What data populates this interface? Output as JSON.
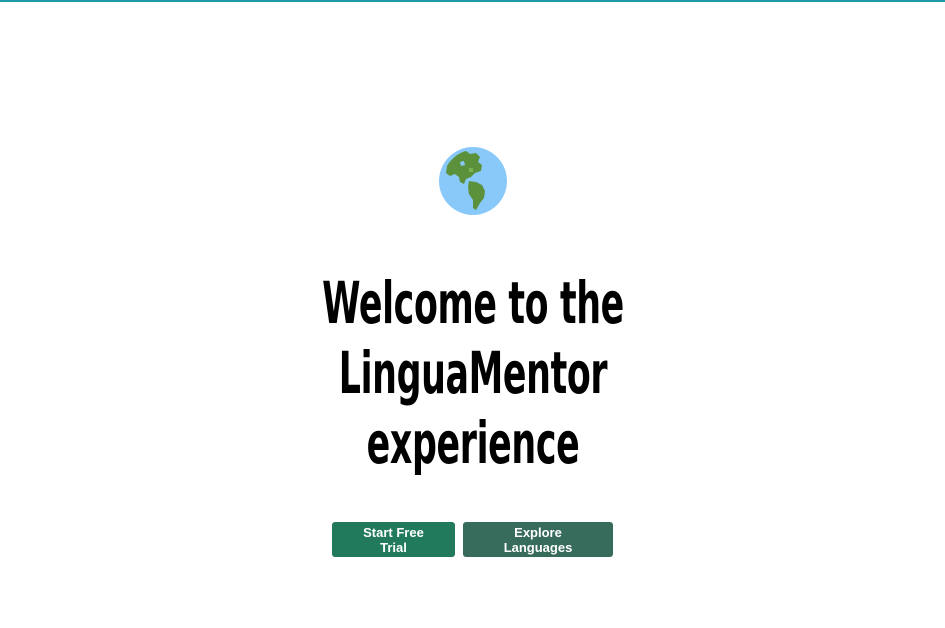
{
  "hero": {
    "icon": "globe-americas-icon",
    "headline": "Welcome to the LinguaMentor experience",
    "primary_button": "Start Free Trial",
    "secondary_button": "Explore Languages"
  },
  "colors": {
    "top_accent": "#1c9aa8",
    "primary_button": "#217a5b",
    "secondary_button": "#376b5c",
    "headline_text": "#000000",
    "background": "#ffffff"
  }
}
